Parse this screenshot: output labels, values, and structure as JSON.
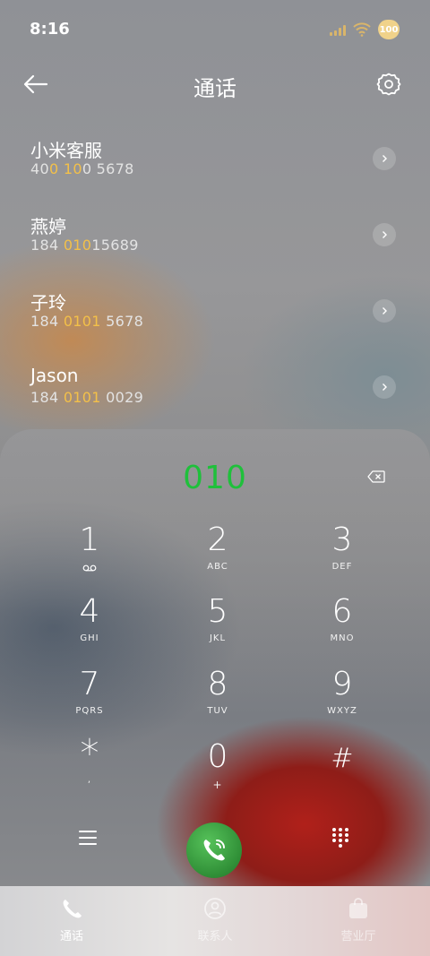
{
  "status_bar": {
    "time": "8:16",
    "battery": "100",
    "icons": [
      "signal-icon",
      "wifi-icon",
      "battery-icon"
    ]
  },
  "header": {
    "title": "通话",
    "back_icon": "back-arrow-icon",
    "settings_icon": "gear-icon"
  },
  "contacts": [
    {
      "name": "小米客服",
      "number_parts": [
        "40",
        "0",
        " ",
        "10",
        "0 5678"
      ]
    },
    {
      "name": "燕婷",
      "number_parts": [
        "184 ",
        "010",
        "15689"
      ]
    },
    {
      "name": "子玲",
      "number_parts": [
        "184 ",
        "0101",
        " 5678"
      ]
    },
    {
      "name": "Jason",
      "number_parts": [
        "184 ",
        "0101",
        " 0029"
      ]
    }
  ],
  "dialpad": {
    "input": "010",
    "keys": [
      {
        "digit": "1",
        "letters": ""
      },
      {
        "digit": "2",
        "letters": "ABC"
      },
      {
        "digit": "3",
        "letters": "DEF"
      },
      {
        "digit": "4",
        "letters": "GHI"
      },
      {
        "digit": "5",
        "letters": "JKL"
      },
      {
        "digit": "6",
        "letters": "MNO"
      },
      {
        "digit": "7",
        "letters": "PQRS"
      },
      {
        "digit": "8",
        "letters": "TUV"
      },
      {
        "digit": "9",
        "letters": "WXYZ"
      },
      {
        "digit": "*",
        "letters": ","
      },
      {
        "digit": "0",
        "letters": "+"
      },
      {
        "digit": "#",
        "letters": ""
      }
    ]
  },
  "tabs": [
    {
      "label": "通话",
      "icon": "phone-icon",
      "active": true
    },
    {
      "label": "联系人",
      "icon": "contact-icon",
      "active": false
    },
    {
      "label": "营业厅",
      "icon": "bag-icon",
      "active": false
    }
  ],
  "colors": {
    "highlight": "#f3c049",
    "dial_input": "#1fc03b",
    "call_button": "#2f8e36"
  }
}
